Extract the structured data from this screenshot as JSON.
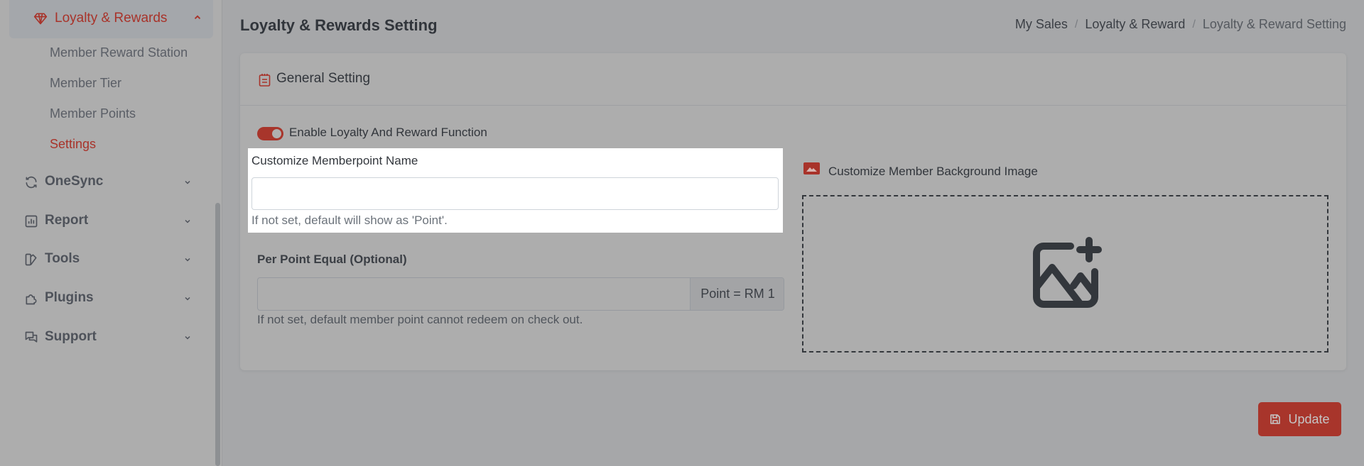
{
  "sidebar": {
    "active_group": {
      "label": "Loyalty & Rewards",
      "icon": "diamond-icon",
      "expanded": true,
      "sub_items": [
        {
          "label": "Member Reward Station",
          "active": false
        },
        {
          "label": "Member Tier",
          "active": false
        },
        {
          "label": "Member Points",
          "active": false
        },
        {
          "label": "Settings",
          "active": true
        }
      ]
    },
    "items": [
      {
        "label": "OneSync",
        "icon": "sync-icon"
      },
      {
        "label": "Report",
        "icon": "report-chart-icon"
      },
      {
        "label": "Tools",
        "icon": "tools-icon"
      },
      {
        "label": "Plugins",
        "icon": "plugin-icon"
      },
      {
        "label": "Support",
        "icon": "support-chat-icon"
      }
    ]
  },
  "header": {
    "title": "Loyalty & Rewards Setting",
    "breadcrumb": [
      "My Sales",
      "Loyalty & Reward",
      "Loyalty & Reward Setting"
    ],
    "breadcrumb_separator": "/"
  },
  "card": {
    "title": "General Setting",
    "icon": "clipboard-icon",
    "toggle": {
      "label": "Enable Loyalty And Reward Function",
      "enabled": true
    },
    "memberpoint_name": {
      "label": "Customize Memberpoint Name",
      "value": "",
      "placeholder": "",
      "help": "If not set, default will show as 'Point'."
    },
    "per_point_equal": {
      "label": "Per Point Equal (Optional)",
      "value": "",
      "placeholder": "",
      "addon": "Point = RM 1",
      "help": "If not set, default member point cannot redeem on check out."
    },
    "background_image": {
      "label": "Customize Member Background Image",
      "icon": "image-icon",
      "dropzone_icon": "add-image-icon"
    }
  },
  "actions": {
    "update_label": "Update",
    "update_icon": "save-icon"
  },
  "colors": {
    "accent": "#a8352b",
    "text": "#31353b"
  }
}
